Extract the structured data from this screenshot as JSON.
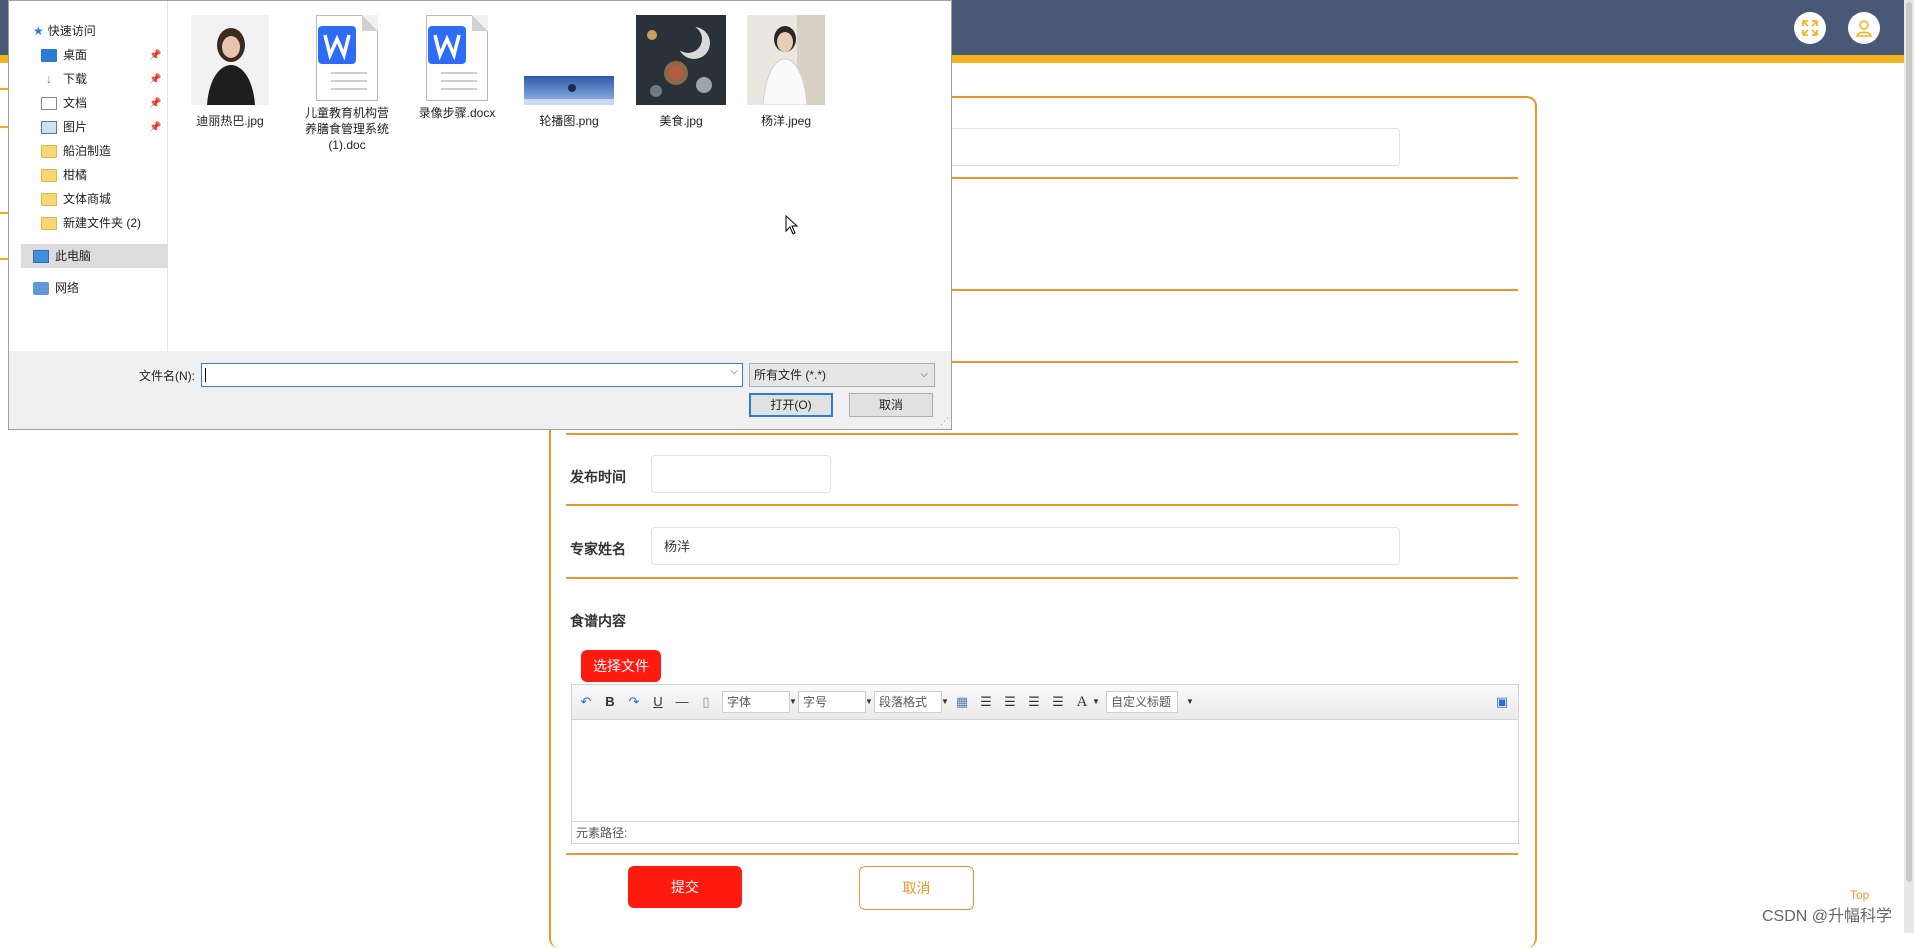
{
  "app": {
    "fullscreen_icon": "fullscreen-icon",
    "user_icon": "user-icon",
    "accent": "#f5b31e",
    "header_bg": "#4a5878"
  },
  "form": {
    "publish_time_label": "发布时间",
    "publish_time_value": "",
    "expert_name_label": "专家姓名",
    "expert_name_value": "杨洋",
    "recipe_content_label": "食谱内容",
    "choose_file_label": "选择文件",
    "submit_label": "提交",
    "cancel_label": "取消"
  },
  "editor": {
    "font_placeholder": "字体",
    "size_placeholder": "字号",
    "paragraph_placeholder": "段落格式",
    "custom_title_placeholder": "自定义标题",
    "element_path_label": "元素路径:",
    "bold": "B",
    "underline": "U",
    "font_color": "A"
  },
  "page_footer": {
    "top_link": "Top",
    "watermark": "CSDN @升幅科学"
  },
  "dialog": {
    "nav": {
      "quick_access": "快速访问",
      "items": [
        {
          "label": "桌面",
          "pinned": true
        },
        {
          "label": "下载",
          "pinned": true
        },
        {
          "label": "文档",
          "pinned": true
        },
        {
          "label": "图片",
          "pinned": true
        },
        {
          "label": "船泊制造",
          "pinned": false
        },
        {
          "label": "柑橘",
          "pinned": false
        },
        {
          "label": "文体商城",
          "pinned": false
        },
        {
          "label": "新建文件夹 (2)",
          "pinned": false
        }
      ],
      "this_pc": "此电脑",
      "network": "网络"
    },
    "files": [
      {
        "name": "迪丽热巴.jpg",
        "kind": "photo-portrait"
      },
      {
        "name": "儿童教育机构营养膳食管理系统(1).doc",
        "kind": "word-doc"
      },
      {
        "name": "录像步骤.docx",
        "kind": "word-doc"
      },
      {
        "name": "轮播图.png",
        "kind": "banner"
      },
      {
        "name": "美食.jpg",
        "kind": "food-photo"
      },
      {
        "name": "杨洋.jpeg",
        "kind": "photo-portrait"
      }
    ],
    "filename_label": "文件名(N):",
    "filename_value": "",
    "filetype_value": "所有文件 (*.*)",
    "open_label": "打开(O)",
    "cancel_label": "取消"
  }
}
